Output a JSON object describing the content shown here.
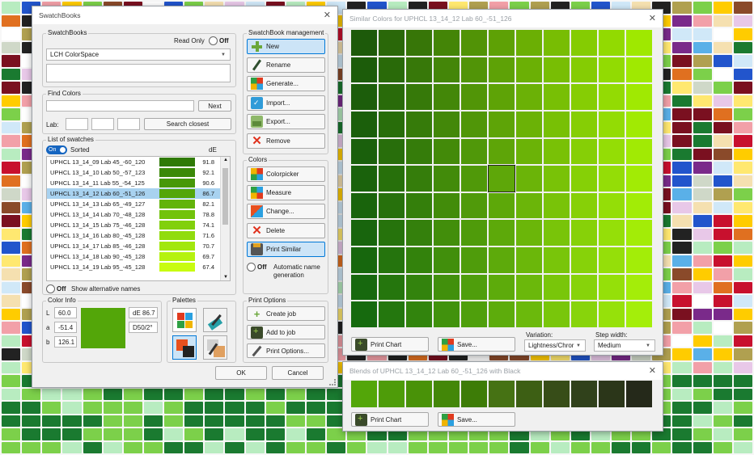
{
  "background_palette": [
    "#c8102e",
    "#7a1020",
    "#f2a0a8",
    "#222222",
    "#ffcc00",
    "#f5e0b0",
    "#e07020",
    "#1a7a30",
    "#7cd04a",
    "#b8ecc0",
    "#8a4a2a",
    "#2255cc",
    "#5ab0e8",
    "#d0e8f8",
    "#7a2a8a",
    "#e8c8e8",
    "#cfd8c8",
    "#ffffff",
    "#ffe870",
    "#b0a050"
  ],
  "swatchbooks_window": {
    "title": "SwatchBooks",
    "swatchbooks_group": {
      "title": "SwatchBooks",
      "read_only_label": "Read Only",
      "read_only_state": "Off",
      "selected_book": "LCH ColorSpace",
      "description": ""
    },
    "find_colors": {
      "title": "Find Colors",
      "search_text": "",
      "next_label": "Next",
      "lab_label": "Lab:",
      "lab_values": [
        "",
        "",
        ""
      ],
      "search_closest_label": "Search closest"
    },
    "list": {
      "title": "List of swatches",
      "sorted_state": "On",
      "sorted_label": "Sorted",
      "de_header": "dE",
      "rows": [
        {
          "name": "UPHCL 13_14_09 Lab 45_-60_120",
          "color": "#2f7a06",
          "de": "91.8",
          "selected": false
        },
        {
          "name": "UPHCL 13_14_10 Lab 50_-57_123",
          "color": "#3b8908",
          "de": "92.1",
          "selected": false
        },
        {
          "name": "UPHCL 13_14_11 Lab 55_-54_125",
          "color": "#479808",
          "de": "90.6",
          "selected": false
        },
        {
          "name": "UPHCL 13_14_12 Lab 60_-51_126",
          "color": "#53a609",
          "de": "86.7",
          "selected": true
        },
        {
          "name": "UPHCL 13_14_13 Lab 65_-49_127",
          "color": "#62b40a",
          "de": "82.1",
          "selected": false
        },
        {
          "name": "UPHCL 13_14_14 Lab 70_-48_128",
          "color": "#72c30b",
          "de": "78.8",
          "selected": false
        },
        {
          "name": "UPHCL 13_14_15 Lab 75_-46_128",
          "color": "#82d00c",
          "de": "74.1",
          "selected": false
        },
        {
          "name": "UPHCL 13_14_16 Lab 80_-45_128",
          "color": "#91dc0d",
          "de": "71.6",
          "selected": false
        },
        {
          "name": "UPHCL 13_14_17 Lab 85_-46_128",
          "color": "#a2e70e",
          "de": "70.7",
          "selected": false
        },
        {
          "name": "UPHCL 13_14_18 Lab 90_-45_128",
          "color": "#b5f20f",
          "de": "69.7",
          "selected": false
        },
        {
          "name": "UPHCL 13_14_19 Lab 95_-45_128",
          "color": "#c8fc10",
          "de": "67.4",
          "selected": false
        }
      ],
      "alt_names_state": "Off",
      "alt_names_label": "Show alternative names"
    },
    "color_info": {
      "title": "Color Info",
      "L_label": "L",
      "L": "60.0",
      "a_label": "a",
      "a": "-51.4",
      "b_label": "b",
      "b": "126.1",
      "swatch_color": "#53a609",
      "de": "dE 86.7",
      "illuminant": "D50/2°"
    },
    "palettes": {
      "title": "Palettes"
    },
    "management": {
      "title": "SwatchBook management",
      "new": "New",
      "rename": "Rename",
      "generate": "Generate...",
      "import": "Import...",
      "export": "Export...",
      "remove": "Remove"
    },
    "colors": {
      "title": "Colors",
      "colorpicker": "Colorpicker",
      "measure": "Measure",
      "change": "Change...",
      "delete": "Delete",
      "print_similar": "Print Similar",
      "auto_name_state": "Off",
      "auto_name_label": "Automatic name generation"
    },
    "print_options": {
      "title": "Print Options",
      "create_job": "Create job",
      "add_to_job": "Add to job",
      "print_options": "Print Options..."
    },
    "ok": "OK",
    "cancel": "Cancel"
  },
  "similar_window": {
    "title": "Similar Colors for UPHCL 13_14_12 Lab 60_-51_126",
    "grid": {
      "rows": 11,
      "cols": 11,
      "selected_row": 5,
      "selected_col": 5,
      "corner_top_left": "#1d5a0a",
      "corner_top_right": "#9fe800",
      "corner_bottom_left": "#166a0e",
      "corner_bottom_right": "#a4ee0a"
    },
    "print_chart": "Print Chart",
    "save": "Save...",
    "variation_label": "Variation:",
    "variation_value": "Lightness/Chror",
    "step_label": "Step width:",
    "step_value": "Medium"
  },
  "blends_window": {
    "title": "Blends of UPHCL 13_14_12 Lab 60_-51_126 with Black",
    "colors": [
      "#53a609",
      "#4e9c09",
      "#499208",
      "#438708",
      "#3d7c07",
      "#467214",
      "#3d5f14",
      "#374d18",
      "#30411b",
      "#2b3619",
      "#25291a"
    ],
    "print_chart": "Print Chart",
    "save": "Save..."
  }
}
